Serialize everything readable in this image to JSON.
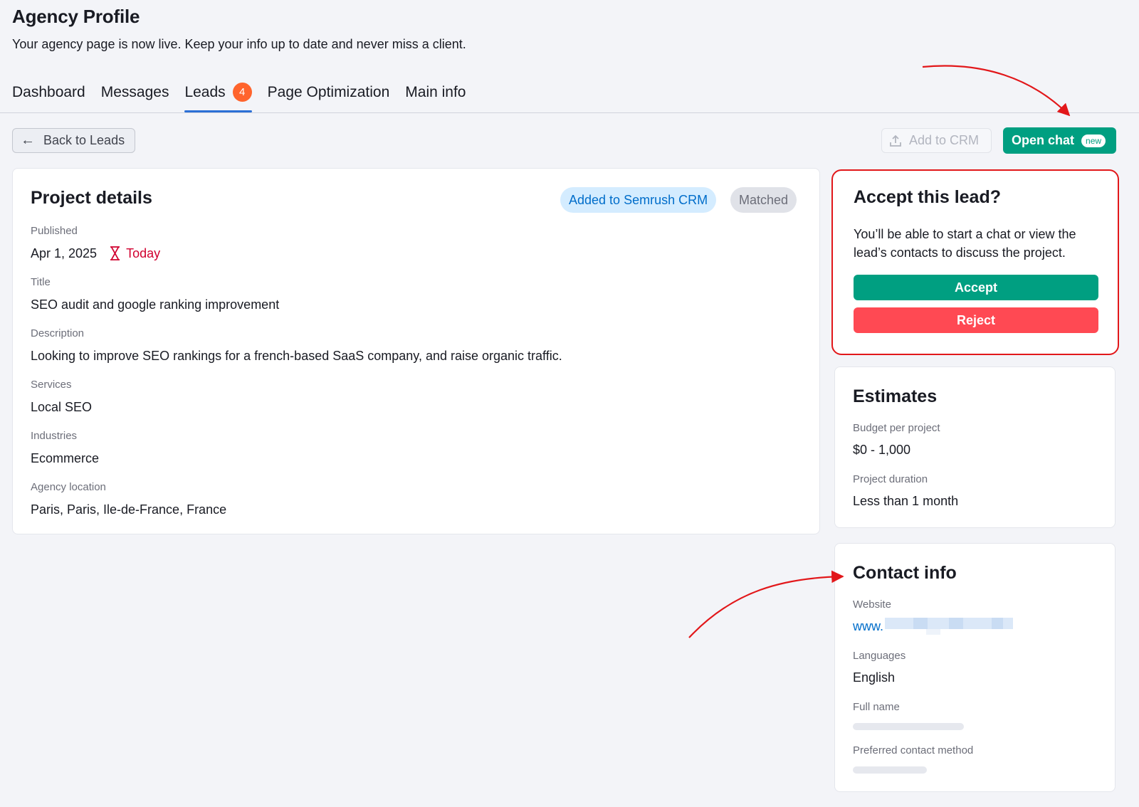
{
  "header": {
    "title": "Agency Profile",
    "subtitle": "Your agency page is now live. Keep your info up to date and never miss a client."
  },
  "tabs": [
    {
      "label": "Dashboard"
    },
    {
      "label": "Messages"
    },
    {
      "label": "Leads",
      "badge": "4",
      "active": true
    },
    {
      "label": "Page Optimization"
    },
    {
      "label": "Main info"
    }
  ],
  "toolbar": {
    "back_label": "Back to Leads",
    "add_crm_label": "Add to CRM",
    "open_chat_label": "Open chat",
    "new_badge": "new"
  },
  "project": {
    "title": "Project details",
    "crm_pill": "Added to Semrush CRM",
    "matched_pill": "Matched",
    "published_label": "Published",
    "published_value": "Apr 1, 2025",
    "published_relative": "Today",
    "title_label": "Title",
    "title_value": "SEO audit and google ranking improvement",
    "description_label": "Description",
    "description_value": "Looking to improve SEO rankings for a french-based SaaS company, and raise organic traffic.",
    "services_label": "Services",
    "services_value": "Local SEO",
    "industries_label": "Industries",
    "industries_value": "Ecommerce",
    "location_label": "Agency location",
    "location_value": "Paris, Paris, Ile-de-France, France"
  },
  "accept": {
    "title": "Accept this lead?",
    "text": "You’ll be able to start a chat or view the lead’s contacts to discuss the project.",
    "accept_label": "Accept",
    "reject_label": "Reject"
  },
  "estimates": {
    "title": "Estimates",
    "budget_label": "Budget per project",
    "budget_value": "$0 - 1,000",
    "duration_label": "Project duration",
    "duration_value": "Less than 1 month"
  },
  "contact": {
    "title": "Contact info",
    "website_label": "Website",
    "website_value": "www.",
    "languages_label": "Languages",
    "languages_value": "English",
    "fullname_label": "Full name",
    "preferred_label": "Preferred contact method"
  },
  "colors": {
    "accent_green": "#009f81",
    "reject_red": "#ff4953",
    "badge_orange": "#ff642d",
    "annotation_red": "#e2171a",
    "tab_underline": "#2b6fd6"
  }
}
